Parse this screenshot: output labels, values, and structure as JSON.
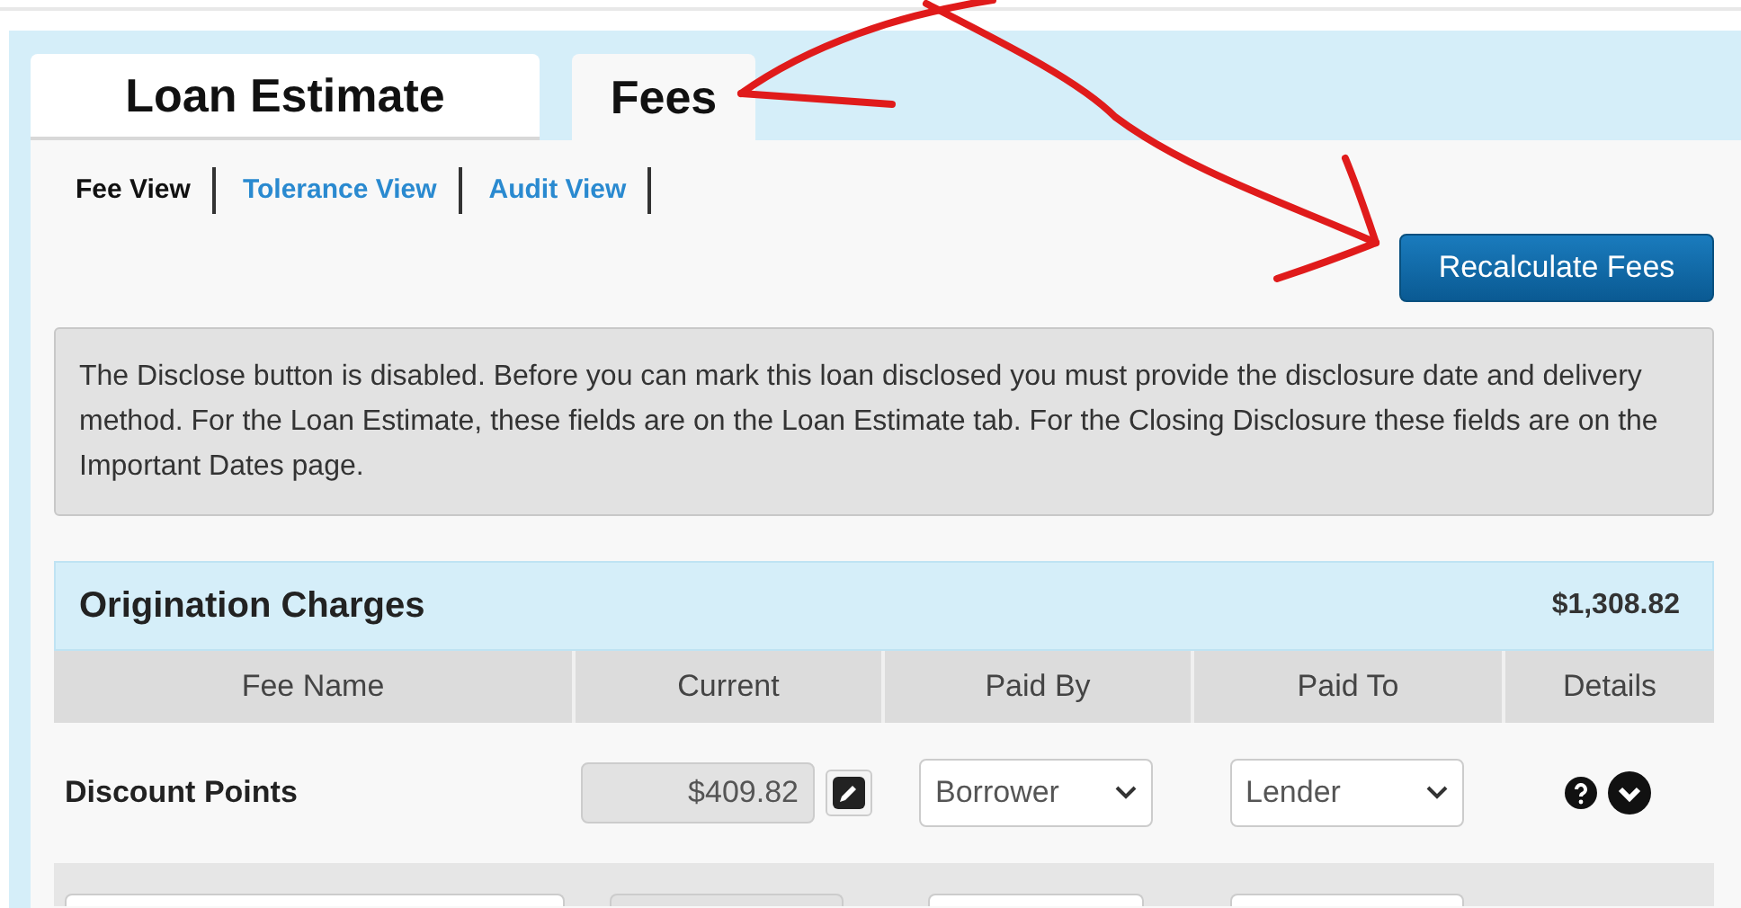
{
  "tabs": [
    {
      "label": "Loan Estimate",
      "selected": false
    },
    {
      "label": "Fees",
      "selected": true
    }
  ],
  "view_links": [
    {
      "label": "Fee View",
      "selected": true
    },
    {
      "label": "Tolerance View",
      "selected": false
    },
    {
      "label": "Audit View",
      "selected": false
    }
  ],
  "recalculate_button": "Recalculate Fees",
  "notice": "The Disclose button is disabled. Before you can mark this loan disclosed you must provide the disclosure date and delivery method. For the Loan Estimate, these fields are on the Loan Estimate tab. For the Closing Disclosure these fields are on the Important Dates page.",
  "section": {
    "title": "Origination Charges",
    "total": "$1,308.82",
    "columns": [
      "Fee Name",
      "Current",
      "Paid By",
      "Paid To",
      "Details"
    ],
    "rows": [
      {
        "kind": "fee",
        "fee_name": "Discount Points",
        "current": "$409.82",
        "paid_by": "Borrower",
        "paid_to": "Lender"
      },
      {
        "kind": "blank"
      }
    ]
  }
}
